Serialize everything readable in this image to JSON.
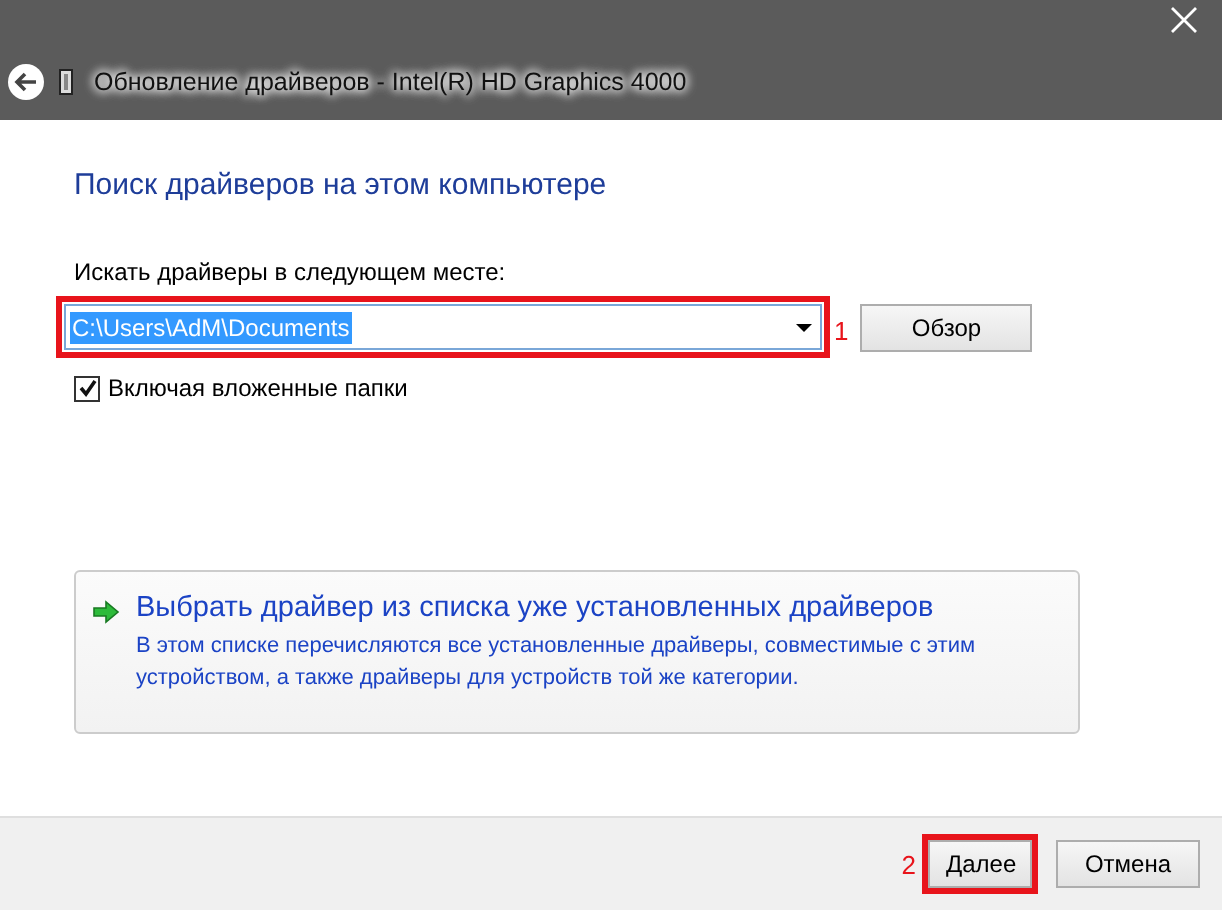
{
  "window": {
    "title": "Обновление драйверов - Intel(R) HD Graphics 4000"
  },
  "heading": "Поиск драйверов на этом компьютере",
  "location": {
    "label": "Искать драйверы в следующем месте:",
    "value": "C:\\Users\\AdM\\Documents",
    "text_selected": true,
    "annotation": "1",
    "browse_button": "Обзор"
  },
  "include_subfolders": {
    "label": "Включая вложенные папки",
    "checked": true
  },
  "command_link": {
    "title": "Выбрать драйвер из списка уже установленных драйверов",
    "description": "В этом списке перечисляются все установленные драйверы, совместимые с этим устройством, а также драйверы для устройств той же категории."
  },
  "buttons": [
    {
      "label": "Далее",
      "annotation": "2"
    },
    {
      "label": "Отмена"
    }
  ]
}
